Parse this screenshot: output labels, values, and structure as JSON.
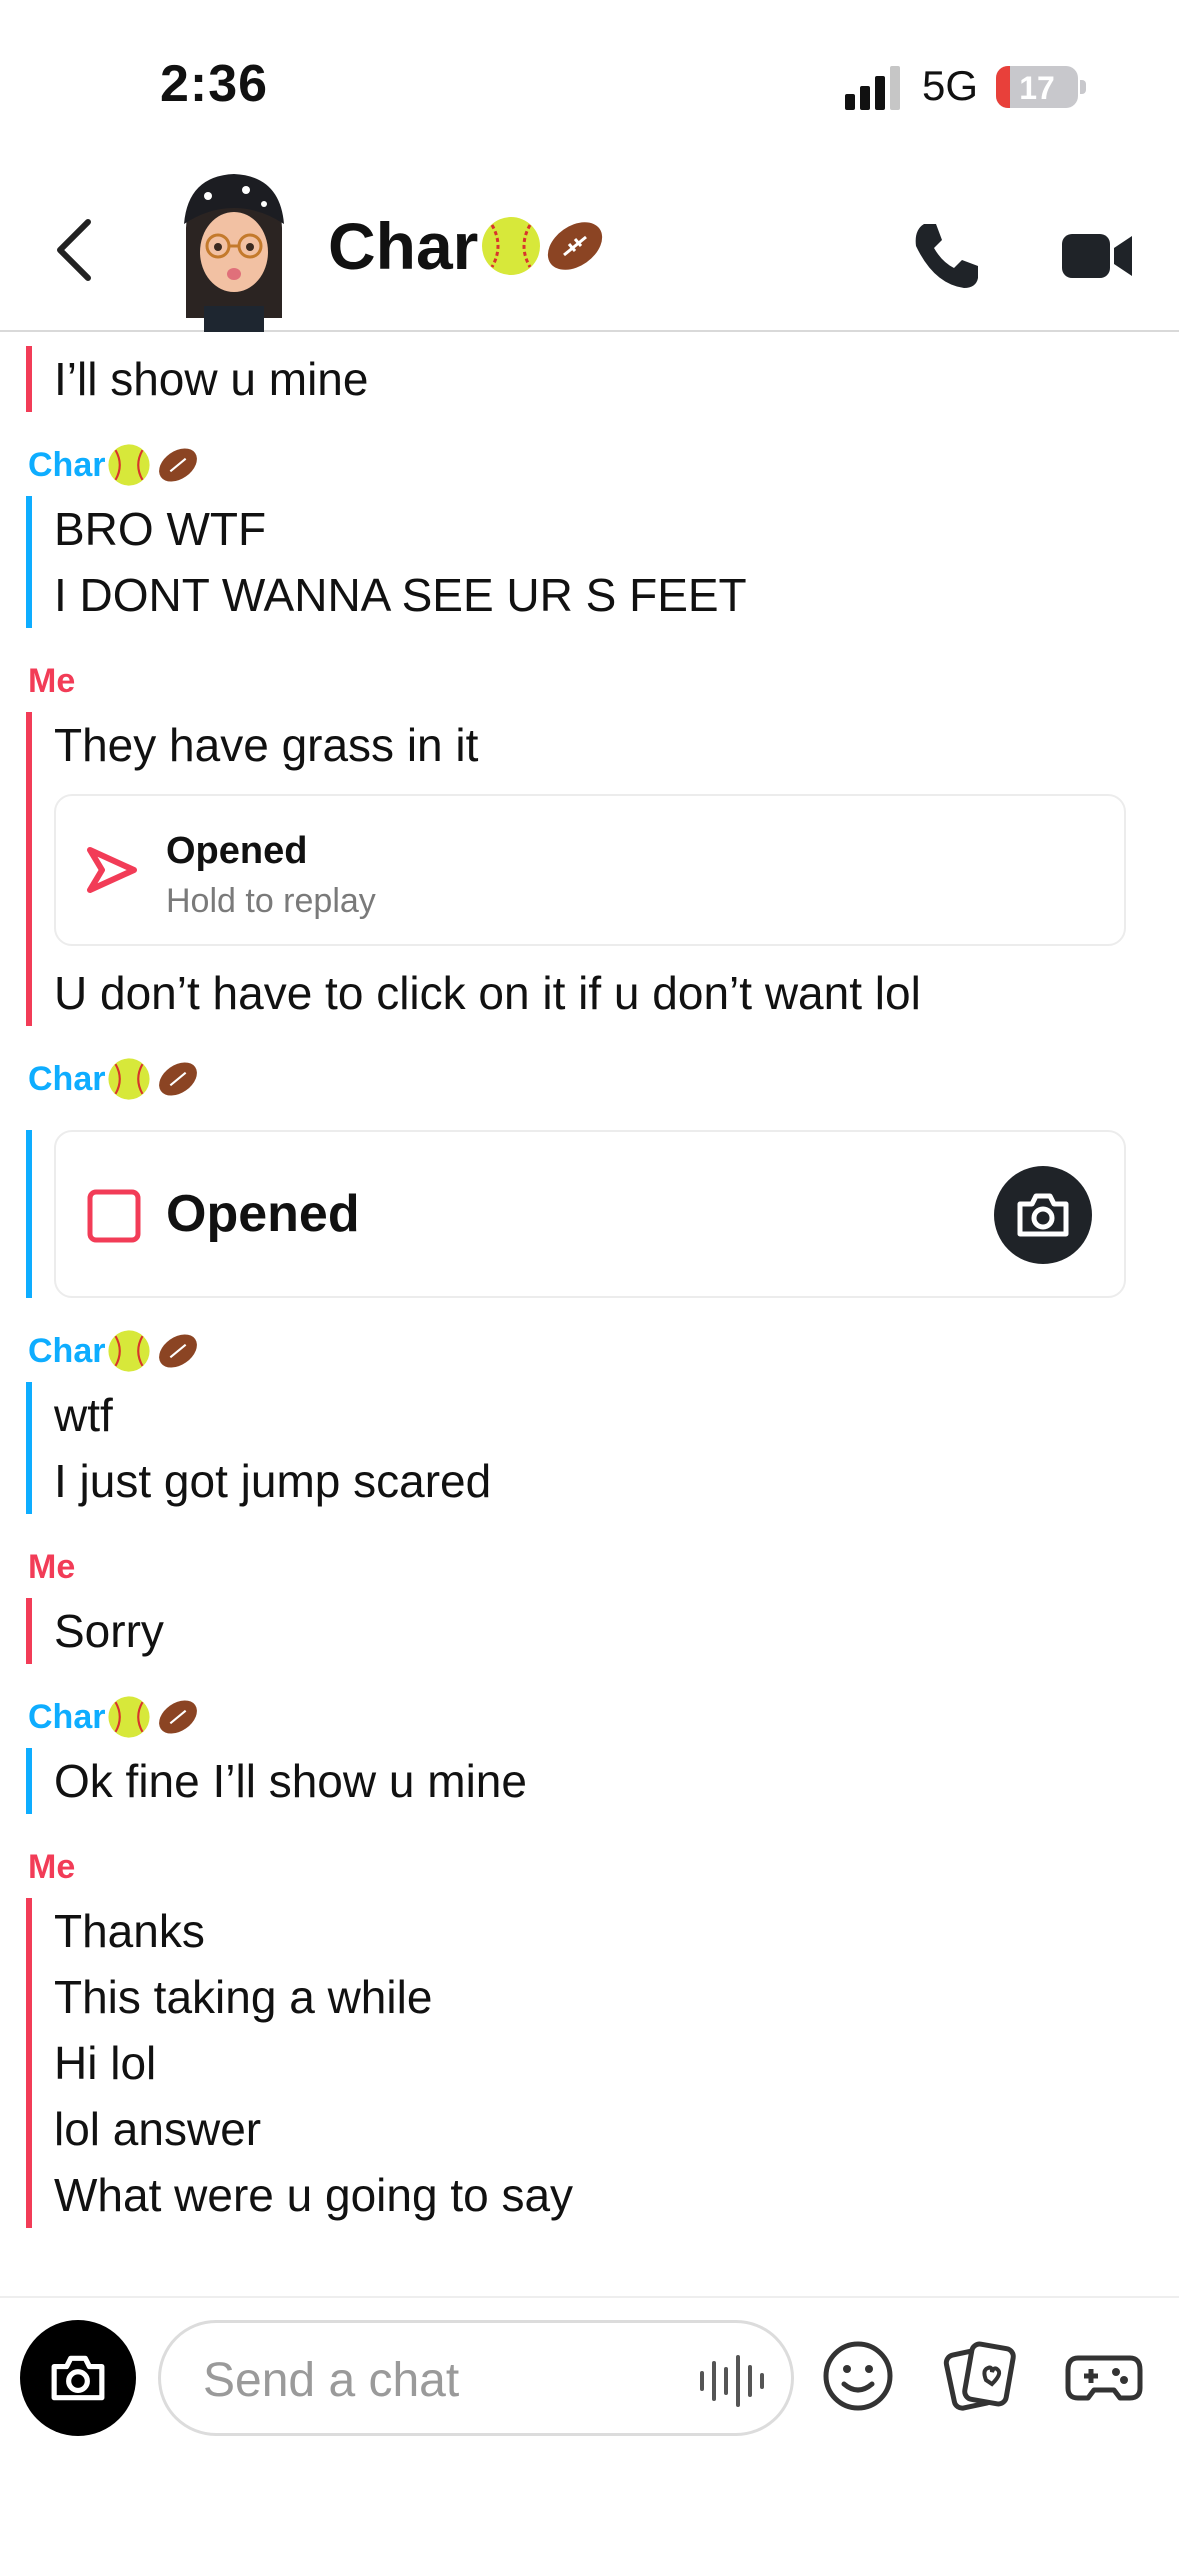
{
  "status_bar": {
    "time": "2:36",
    "network": "5G",
    "battery": "17",
    "battery_level": 0.17
  },
  "header": {
    "contact_name": "Char",
    "name_emojis": [
      "softball-icon",
      "football-icon"
    ]
  },
  "colors": {
    "me": "#f23c57",
    "friend": "#0eadff"
  },
  "messages": [
    {
      "sender": "Me",
      "lines": [
        "I’ll show u mine"
      ]
    },
    {
      "sender": "Char",
      "lines": [
        "BRO WTF",
        "I DONT WANNA SEE UR S FEET"
      ]
    },
    {
      "sender": "Me",
      "lines": [
        "They have grass in it"
      ],
      "snap": {
        "title": "Opened",
        "subtitle": "Hold to replay"
      },
      "after": [
        "U don’t have to click on it if u don’t want lol"
      ]
    },
    {
      "sender": "Char",
      "snap": {
        "title": "Opened"
      }
    },
    {
      "sender": "Char",
      "lines": [
        "wtf",
        "I just got jump scared"
      ]
    },
    {
      "sender": "Me",
      "lines": [
        "Sorry"
      ]
    },
    {
      "sender": "Char",
      "lines": [
        "Ok fine I’ll show u mine"
      ]
    },
    {
      "sender": "Me",
      "lines": [
        "Thanks",
        "This taking a while",
        "Hi lol",
        "lol answer",
        "What were u going to say"
      ]
    }
  ],
  "composer": {
    "placeholder": "Send a chat"
  }
}
